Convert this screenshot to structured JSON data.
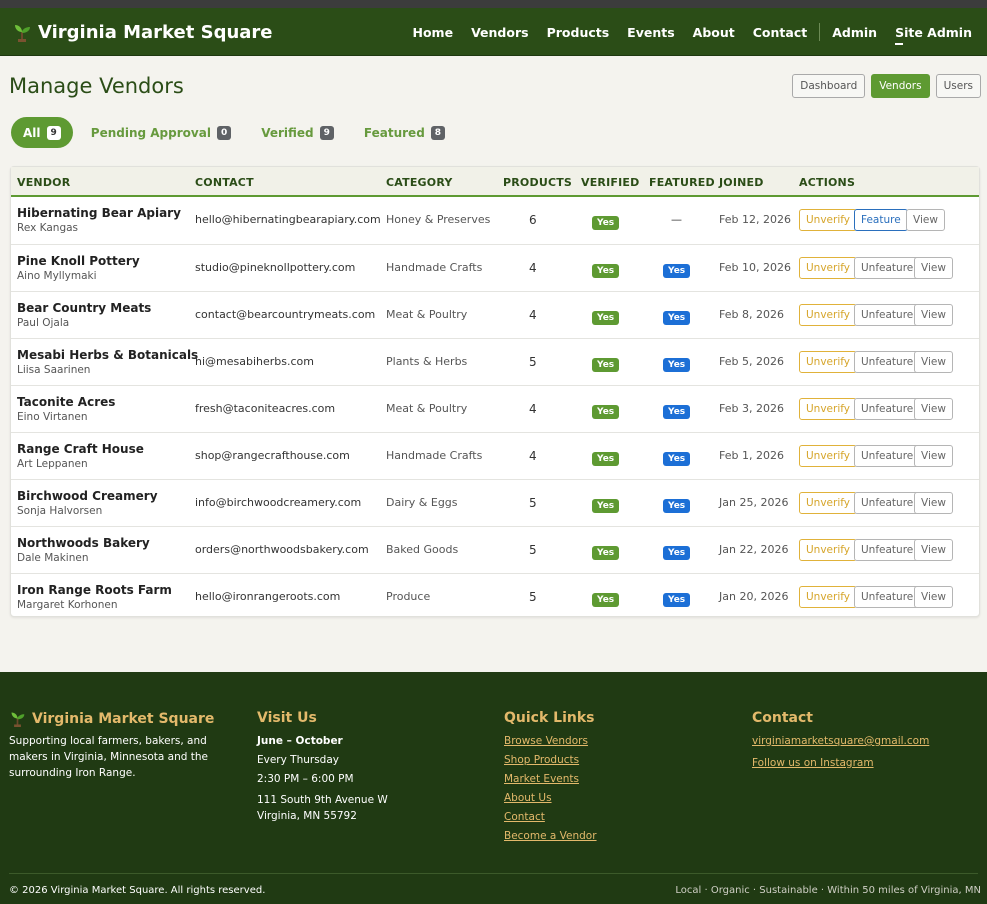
{
  "brand": {
    "title": "Virginia Market Square"
  },
  "nav": {
    "items": [
      "Home",
      "Vendors",
      "Products",
      "Events",
      "About",
      "Contact"
    ],
    "admin": "Admin",
    "site_admin": "Site Admin"
  },
  "page": {
    "title": "Manage Vendors"
  },
  "admin_tabs": {
    "dashboard": "Dashboard",
    "vendors": "Vendors",
    "users": "Users"
  },
  "filters": [
    {
      "label": "All",
      "count": "9"
    },
    {
      "label": "Pending Approval",
      "count": "0"
    },
    {
      "label": "Verified",
      "count": "9"
    },
    {
      "label": "Featured",
      "count": "8"
    }
  ],
  "table": {
    "headers": [
      "VENDOR",
      "CONTACT",
      "CATEGORY",
      "PRODUCTS",
      "VERIFIED",
      "FEATURED",
      "JOINED",
      "ACTIONS"
    ],
    "rows": [
      {
        "name": "Hibernating Bear Apiary",
        "person": "Rex Kangas",
        "email": "hello@hibernatingbearapiary.com",
        "category": "Honey & Preserves",
        "products": "6",
        "verified": "Yes",
        "featured": "—",
        "joined": "Feb 12, 2026",
        "a1": "Unverify",
        "a2": "Feature",
        "a3": "View"
      },
      {
        "name": "Pine Knoll Pottery",
        "person": "Aino Myllymaki",
        "email": "studio@pineknollpottery.com",
        "category": "Handmade Crafts",
        "products": "4",
        "verified": "Yes",
        "featured": "Yes",
        "joined": "Feb 10, 2026",
        "a1": "Unverify",
        "a2": "Unfeature",
        "a3": "View"
      },
      {
        "name": "Bear Country Meats",
        "person": "Paul Ojala",
        "email": "contact@bearcountrymeats.com",
        "category": "Meat & Poultry",
        "products": "4",
        "verified": "Yes",
        "featured": "Yes",
        "joined": "Feb 8, 2026",
        "a1": "Unverify",
        "a2": "Unfeature",
        "a3": "View"
      },
      {
        "name": "Mesabi Herbs & Botanicals",
        "person": "Liisa Saarinen",
        "email": "hi@mesabiherbs.com",
        "category": "Plants & Herbs",
        "products": "5",
        "verified": "Yes",
        "featured": "Yes",
        "joined": "Feb 5, 2026",
        "a1": "Unverify",
        "a2": "Unfeature",
        "a3": "View"
      },
      {
        "name": "Taconite Acres",
        "person": "Eino Virtanen",
        "email": "fresh@taconiteacres.com",
        "category": "Meat & Poultry",
        "products": "4",
        "verified": "Yes",
        "featured": "Yes",
        "joined": "Feb 3, 2026",
        "a1": "Unverify",
        "a2": "Unfeature",
        "a3": "View"
      },
      {
        "name": "Range Craft House",
        "person": "Art Leppanen",
        "email": "shop@rangecrafthouse.com",
        "category": "Handmade Crafts",
        "products": "4",
        "verified": "Yes",
        "featured": "Yes",
        "joined": "Feb 1, 2026",
        "a1": "Unverify",
        "a2": "Unfeature",
        "a3": "View"
      },
      {
        "name": "Birchwood Creamery",
        "person": "Sonja Halvorsen",
        "email": "info@birchwoodcreamery.com",
        "category": "Dairy & Eggs",
        "products": "5",
        "verified": "Yes",
        "featured": "Yes",
        "joined": "Jan 25, 2026",
        "a1": "Unverify",
        "a2": "Unfeature",
        "a3": "View"
      },
      {
        "name": "Northwoods Bakery",
        "person": "Dale Makinen",
        "email": "orders@northwoodsbakery.com",
        "category": "Baked Goods",
        "products": "5",
        "verified": "Yes",
        "featured": "Yes",
        "joined": "Jan 22, 2026",
        "a1": "Unverify",
        "a2": "Unfeature",
        "a3": "View"
      },
      {
        "name": "Iron Range Roots Farm",
        "person": "Margaret Korhonen",
        "email": "hello@ironrangeroots.com",
        "category": "Produce",
        "products": "5",
        "verified": "Yes",
        "featured": "Yes",
        "joined": "Jan 20, 2026",
        "a1": "Unverify",
        "a2": "Unfeature",
        "a3": "View"
      }
    ]
  },
  "footer": {
    "brand_title": "Virginia Market Square",
    "brand_text": "Supporting local farmers, bakers, and makers in Virginia, Minnesota and the surrounding Iron Range.",
    "visit_title": "Visit Us",
    "visit_season": "June – October",
    "visit_day": "Every Thursday",
    "visit_time": "2:30 PM – 6:00 PM",
    "visit_address1": "111 South 9th Avenue W",
    "visit_address2": "Virginia, MN 55792",
    "links_title": "Quick Links",
    "links": [
      "Browse Vendors",
      "Shop Products",
      "Market Events",
      "About Us",
      "Contact",
      "Become a Vendor"
    ],
    "contact_title": "Contact",
    "contact_email": "virginiamarketsquare@gmail.com",
    "contact_instagram": "Follow us on Instagram",
    "copyright": "© 2026 Virginia Market Square. All rights reserved.",
    "tagline": "Local · Organic · Sustainable · Within 50 miles of Virginia, MN"
  },
  "colors": {
    "brand_green": "#2b4d17",
    "accent_green": "#5e9a32",
    "featured_blue": "#1c6fd6",
    "footer_bg": "#203a13",
    "footer_gold": "#e3b96b"
  }
}
